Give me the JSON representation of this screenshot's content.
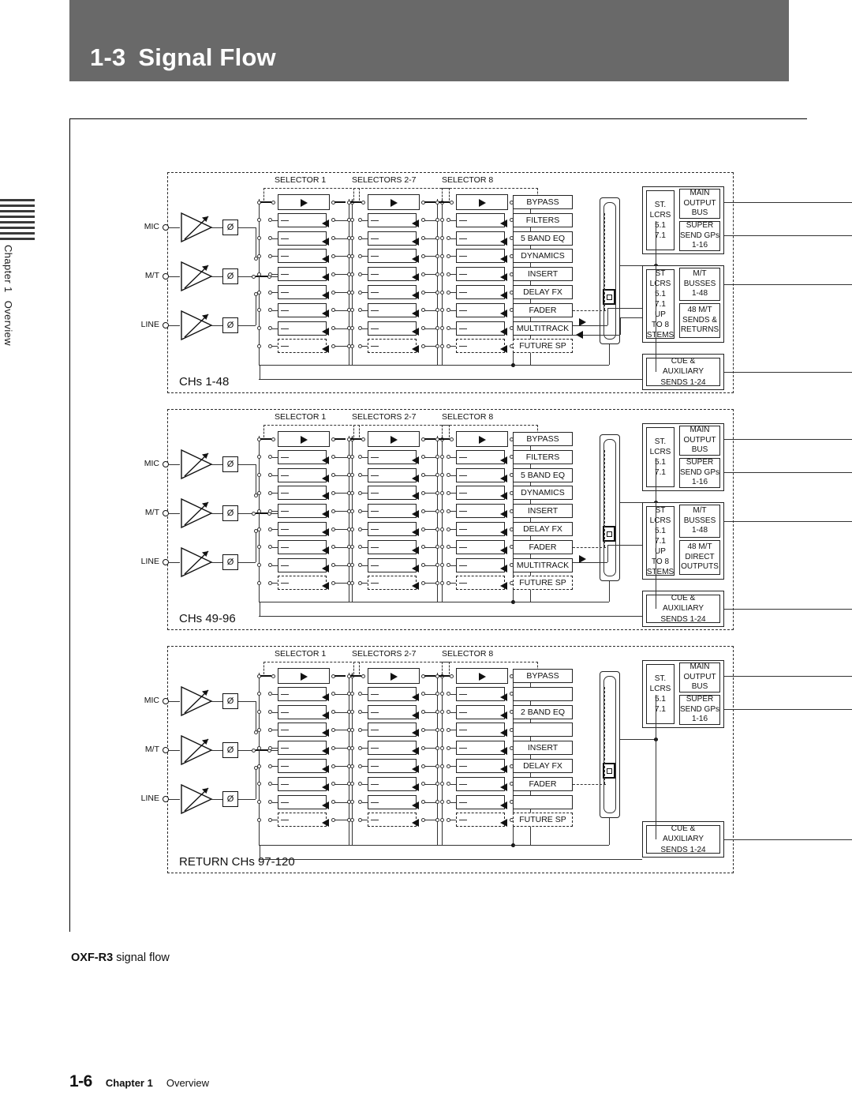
{
  "header": {
    "section_number": "1-3",
    "title": "Signal Flow"
  },
  "side_tab": {
    "chapter": "Chapter 1",
    "section": "Overview"
  },
  "figure": {
    "caption_bold": "OXF-R3",
    "caption_rest": " signal flow"
  },
  "footer": {
    "page": "1-6",
    "chapter": "Chapter 1",
    "section": "Overview"
  },
  "selector_headers": {
    "first": "SELECTOR 1",
    "middle": "SELECTORS 2-7",
    "last": "SELECTOR 8"
  },
  "inputs": {
    "mic": "MIC",
    "mt": "M/T",
    "line": "LINE",
    "phase": "Ø"
  },
  "blocks": [
    {
      "id": "chs-1-48",
      "label": "CHs 1-48",
      "processing": [
        "BYPASS",
        "FILTERS",
        "5 BAND EQ",
        "DYNAMICS",
        "INSERT",
        "DELAY FX",
        "FADER",
        "MULTITRACK",
        "FUTURE SP"
      ],
      "outputs": {
        "main_formats": [
          "ST.",
          "LCRS",
          "5.1",
          "7.1"
        ],
        "main_bus": "MAIN\nOUTPUT\nBUS",
        "super_send": "SUPER\nSEND GPs\n1-16",
        "mt_formats": [
          "ST",
          "LCRS",
          "5.1",
          "7.1",
          "UP",
          "TO 8",
          "STEMS"
        ],
        "mt_busses": "M/T\nBUSSES\n1-48",
        "mt_direct": "48 M/T\nSENDS  &\nRETURNS",
        "cue_aux": "CUE &\nAUXILIARY\nSENDS 1-24"
      }
    },
    {
      "id": "chs-49-96",
      "label": "CHs 49-96",
      "processing": [
        "BYPASS",
        "FILTERS",
        "5 BAND EQ",
        "DYNAMICS",
        "INSERT",
        "DELAY FX",
        "FADER",
        "MULTITRACK",
        "FUTURE SP"
      ],
      "outputs": {
        "main_formats": [
          "ST.",
          "LCRS",
          "5.1",
          "7.1"
        ],
        "main_bus": "MAIN\nOUTPUT\nBUS",
        "super_send": "SUPER\nSEND GPs\n1-16",
        "mt_formats": [
          "ST",
          "LCRS",
          "5.1",
          "7.1",
          "UP",
          "TO 8",
          "STEMS"
        ],
        "mt_busses": "M/T\nBUSSES\n1-48",
        "mt_direct": "48 M/T\nDIRECT\nOUTPUTS",
        "cue_aux": "CUE &\nAUXILIARY\nSENDS 1-24"
      }
    },
    {
      "id": "return-chs-97-120",
      "label": "RETURN CHs 97-120",
      "processing": [
        "BYPASS",
        "",
        "2 BAND EQ",
        "",
        "INSERT",
        "DELAY FX",
        "FADER",
        "",
        "FUTURE SP"
      ],
      "outputs": {
        "main_formats": [
          "ST.",
          "LCRS",
          "5.1",
          "7.1"
        ],
        "main_bus": "MAIN\nOUTPUT\nBUS",
        "super_send": "SUPER\nSEND GPs\n1-16",
        "mt_formats": [],
        "mt_busses": "",
        "mt_direct": "",
        "cue_aux": "CUE &\nAUXILIARY\nSENDS 1-24"
      }
    }
  ]
}
